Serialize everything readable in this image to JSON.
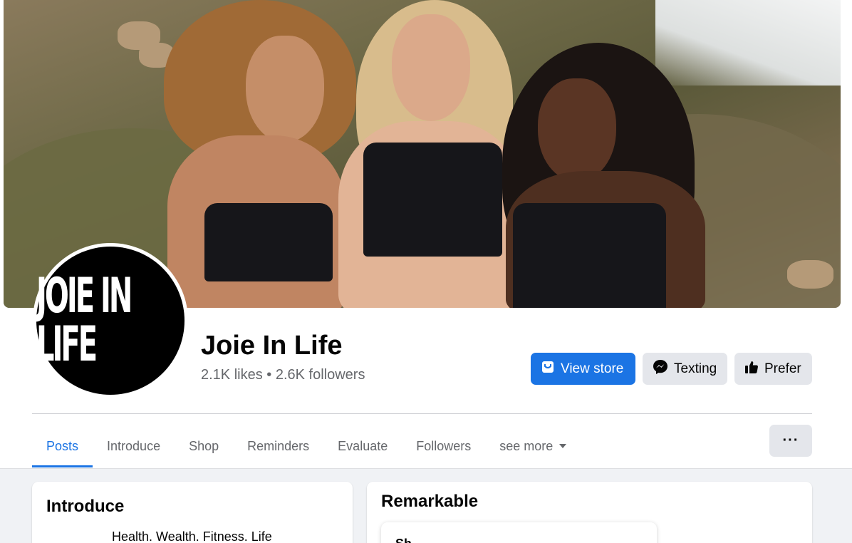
{
  "page": {
    "name": "Joie In Life",
    "stats": "2.1K likes • 2.6K followers",
    "logo_text": "JOIE IN LIFE"
  },
  "actions": {
    "view_store": "View store",
    "texting": "Texting",
    "prefer": "Prefer"
  },
  "tabs": [
    {
      "label": "Posts"
    },
    {
      "label": "Introduce"
    },
    {
      "label": "Shop"
    },
    {
      "label": "Reminders"
    },
    {
      "label": "Evaluate"
    },
    {
      "label": "Followers"
    },
    {
      "label": "see more"
    }
  ],
  "more_menu": "···",
  "intro": {
    "title": "Introduce",
    "bio": "Health. Wealth. Fitness. Life"
  },
  "remarkable": {
    "title": "Remarkable",
    "sub": "Sh"
  },
  "colors": {
    "primary": "#1b74e4",
    "gray_button": "#e4e6eb",
    "muted_text": "#65676b",
    "background": "#f0f2f5"
  }
}
